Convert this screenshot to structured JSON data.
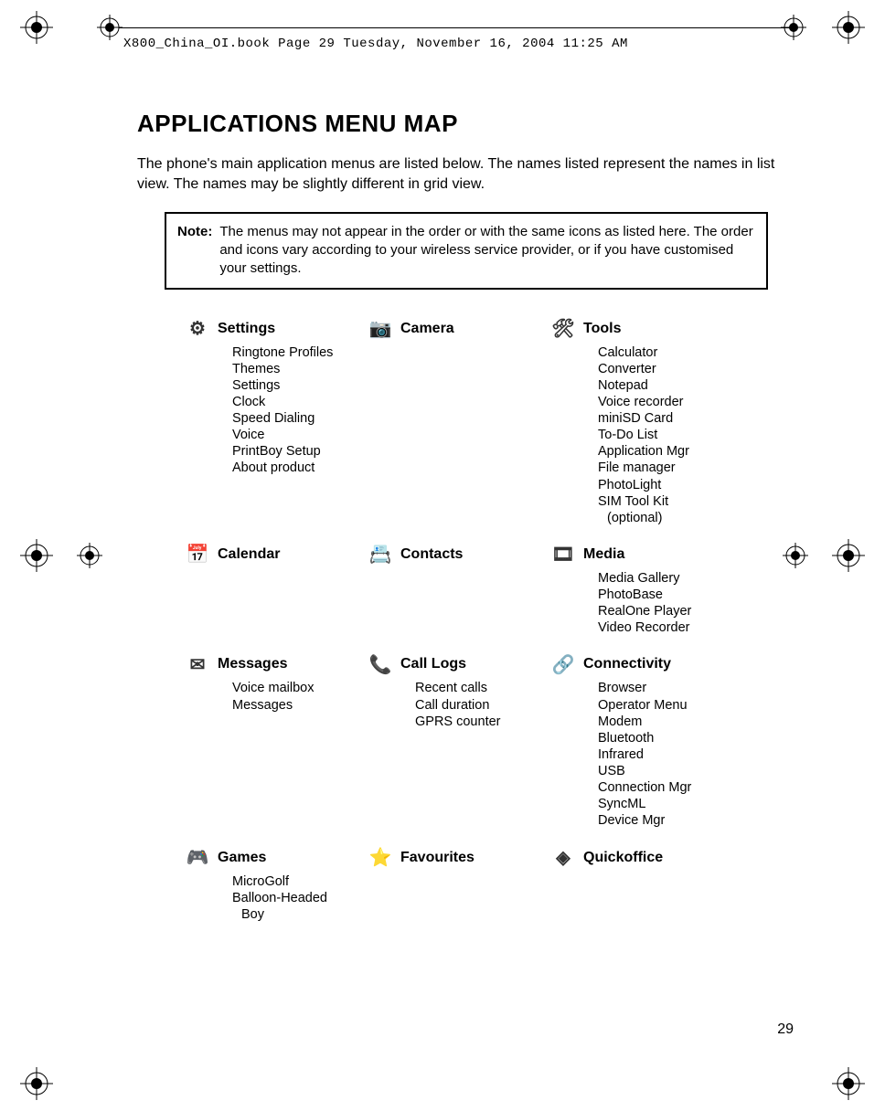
{
  "header": "X800_China_OI.book  Page 29  Tuesday, November 16, 2004  11:25 AM",
  "title": "APPLICATIONS MENU MAP",
  "intro": "The phone's main application menus are listed below. The names listed represent the names in list view. The names may be slightly different in grid view.",
  "note_label": "Note:",
  "note_text": "The menus may not appear in the order or with the same icons as listed here. The order and icons vary according to your wireless service provider, or if you have customised your settings.",
  "rows": [
    {
      "cols": [
        {
          "icon": "settings-icon",
          "title": "Settings",
          "items": [
            "Ringtone Profiles",
            "Themes",
            "Settings",
            "Clock",
            "Speed Dialing",
            "Voice",
            "PrintBoy Setup",
            "About product"
          ]
        },
        {
          "icon": "camera-icon",
          "title": "Camera",
          "items": []
        },
        {
          "icon": "tools-icon",
          "title": "Tools",
          "items": [
            "Calculator",
            "Converter",
            "Notepad",
            "Voice recorder",
            "miniSD Card",
            "To-Do List",
            "Application Mgr",
            "File manager",
            "PhotoLight",
            "SIM Tool Kit",
            "  (optional)"
          ]
        }
      ]
    },
    {
      "cols": [
        {
          "icon": "calendar-icon",
          "title": "Calendar",
          "items": []
        },
        {
          "icon": "contacts-icon",
          "title": "Contacts",
          "items": []
        },
        {
          "icon": "media-icon",
          "title": "Media",
          "items": [
            "Media Gallery",
            "PhotoBase",
            "RealOne Player",
            "Video Recorder"
          ]
        }
      ]
    },
    {
      "cols": [
        {
          "icon": "messages-icon",
          "title": "Messages",
          "items": [
            "Voice mailbox",
            "Messages"
          ]
        },
        {
          "icon": "call-logs-icon",
          "title": "Call Logs",
          "items": [
            "Recent calls",
            "Call duration",
            "GPRS counter"
          ]
        },
        {
          "icon": "connectivity-icon",
          "title": "Connectivity",
          "items": [
            "Browser",
            "Operator Menu",
            "Modem",
            "Bluetooth",
            "Infrared",
            "USB",
            "Connection Mgr",
            "SyncML",
            "Device Mgr"
          ]
        }
      ]
    },
    {
      "cols": [
        {
          "icon": "games-icon",
          "title": "Games",
          "items": [
            "MicroGolf",
            "Balloon-Headed",
            "  Boy"
          ]
        },
        {
          "icon": "favourites-icon",
          "title": "Favourites",
          "items": []
        },
        {
          "icon": "quickoffice-icon",
          "title": "Quickoffice",
          "items": []
        }
      ]
    }
  ],
  "page_number": "29",
  "icons": {
    "settings-icon": "⚙",
    "camera-icon": "📷",
    "tools-icon": "🛠",
    "calendar-icon": "📅",
    "contacts-icon": "📇",
    "media-icon": "🎞",
    "messages-icon": "✉",
    "call-logs-icon": "📞",
    "connectivity-icon": "🔗",
    "games-icon": "🎮",
    "favourites-icon": "⭐",
    "quickoffice-icon": "◈"
  }
}
